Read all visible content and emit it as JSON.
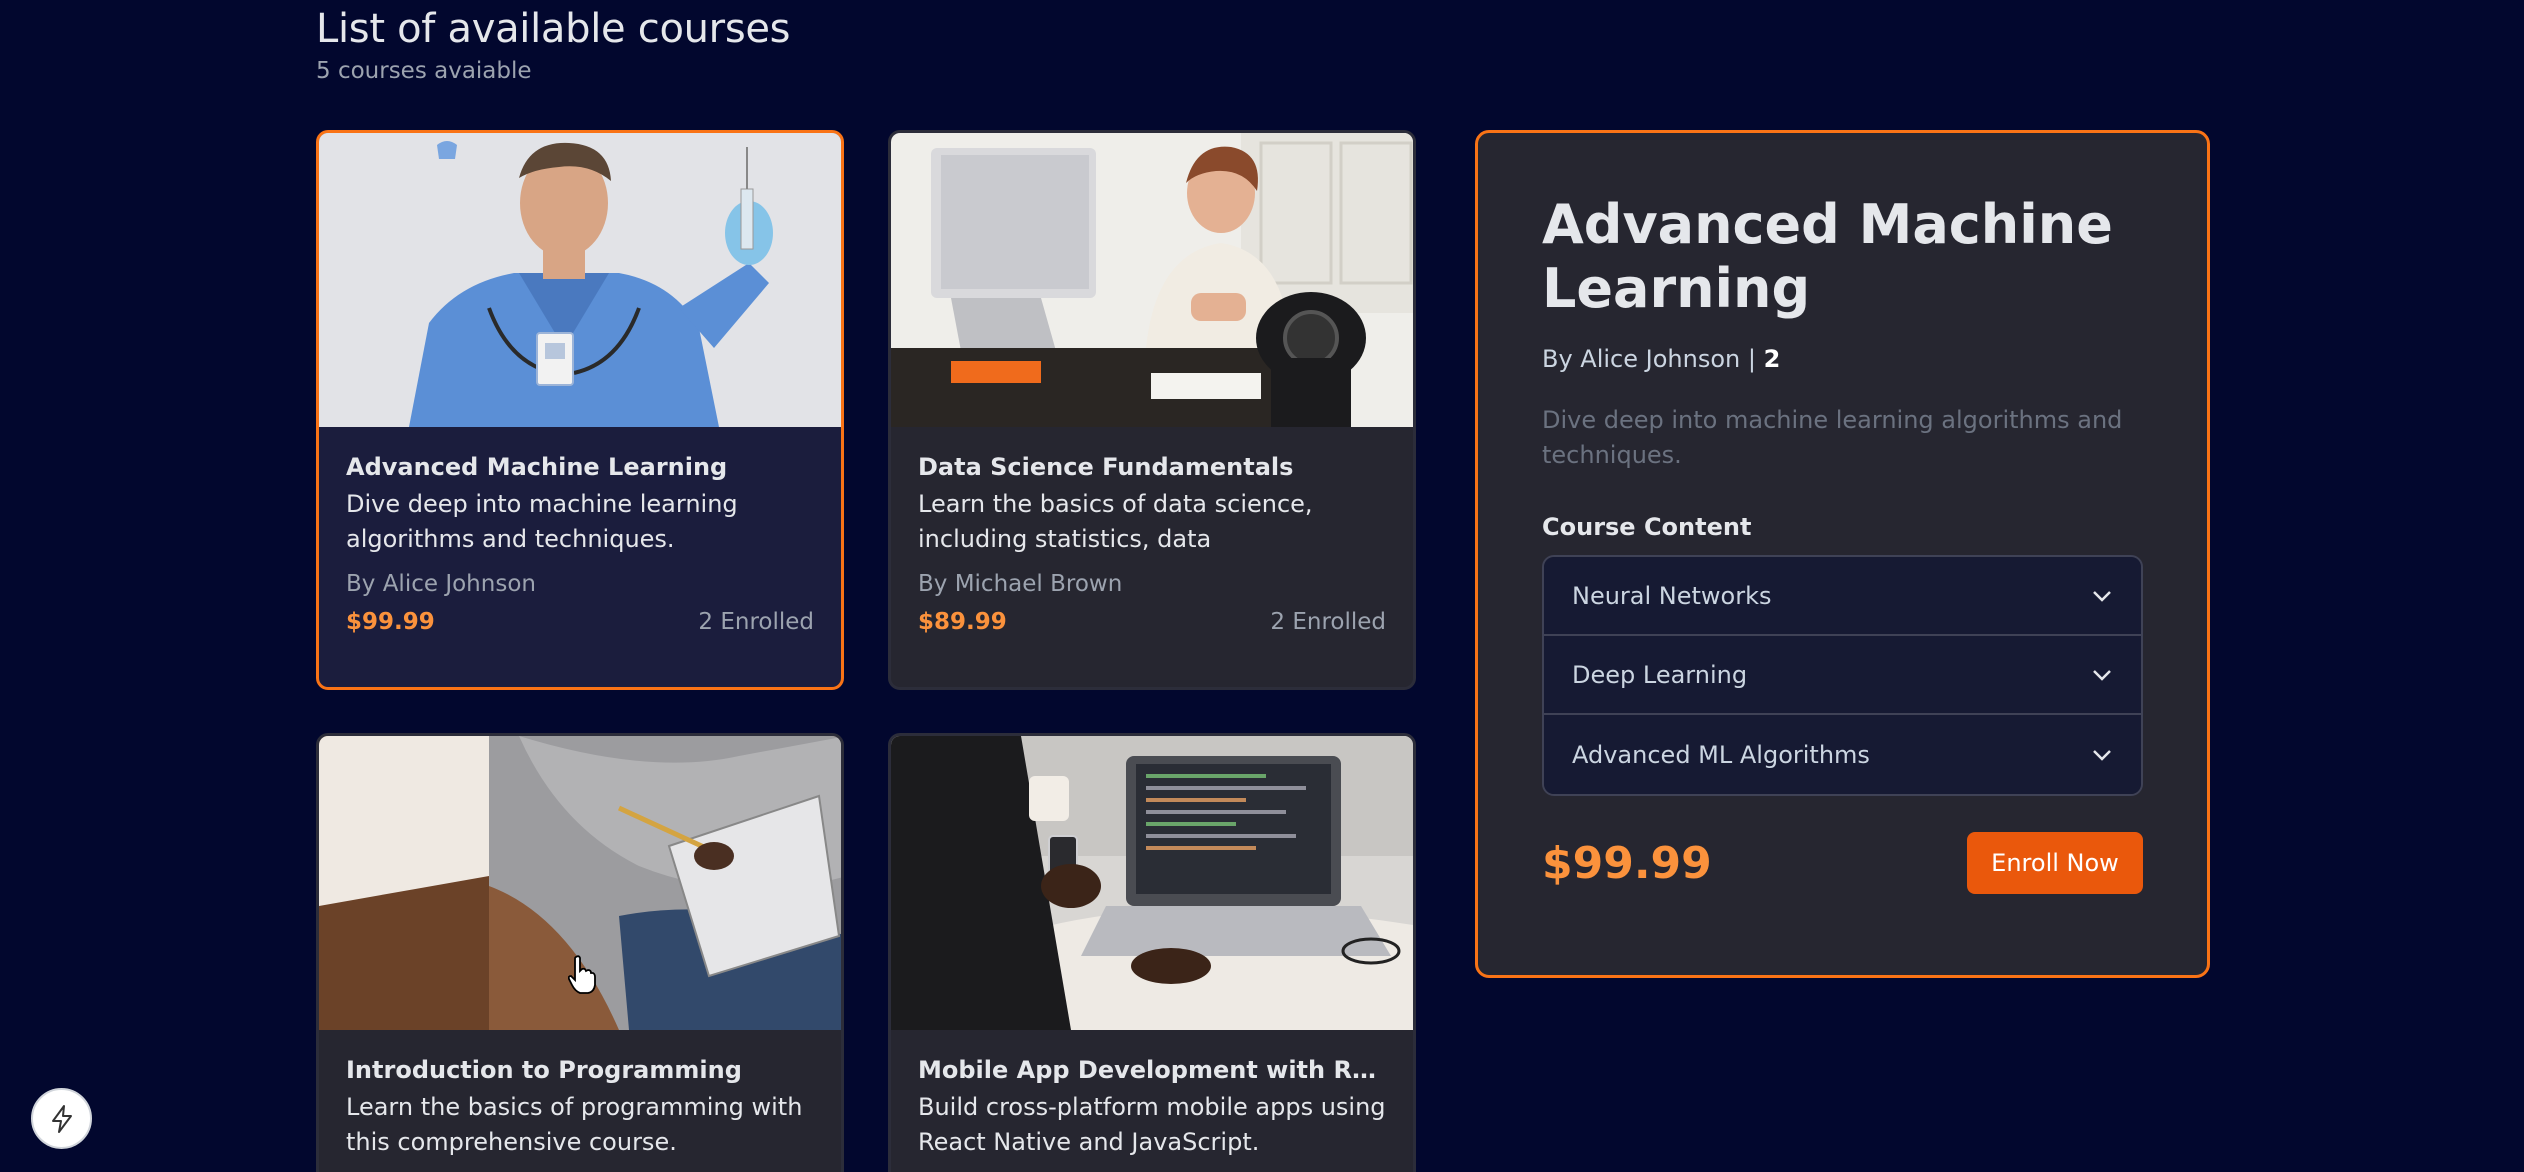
{
  "header": {
    "title": "List of available courses",
    "subtitle": "5 courses avaiable"
  },
  "courses": [
    {
      "title": "Advanced Machine Learning",
      "description": "Dive deep into machine learning algorithms and techniques.",
      "author": "By Alice Johnson",
      "price": "$99.99",
      "enrolled": "2 Enrolled",
      "selected": true
    },
    {
      "title": "Data Science Fundamentals",
      "description": "Learn the basics of data science, including statistics, data visualization,...",
      "author": "By Michael Brown",
      "price": "$89.99",
      "enrolled": "2 Enrolled",
      "selected": false
    },
    {
      "title": "Introduction to Programming",
      "description": "Learn the basics of programming with this comprehensive course."
    },
    {
      "title": "Mobile App Development with React...",
      "description": "Build cross-platform mobile apps using React Native and JavaScript."
    }
  ],
  "detail": {
    "title": "Advanced Machine Learning",
    "author_prefix": "By Alice Johnson | ",
    "count": "2",
    "description": "Dive deep into machine learning algorithms and techniques.",
    "content_label": "Course Content",
    "modules": [
      "Neural Networks",
      "Deep Learning",
      "Advanced ML Algorithms"
    ],
    "price": "$99.99",
    "enroll_label": "Enroll Now"
  },
  "colors": {
    "background": "#02072e",
    "card": "#262630",
    "selected_card": "#1b1d3d",
    "accent": "#f97316",
    "price": "#fb923c"
  },
  "icons": [
    "chevron-down-icon",
    "lightning-bolt-icon",
    "hand-pointer-cursor"
  ]
}
